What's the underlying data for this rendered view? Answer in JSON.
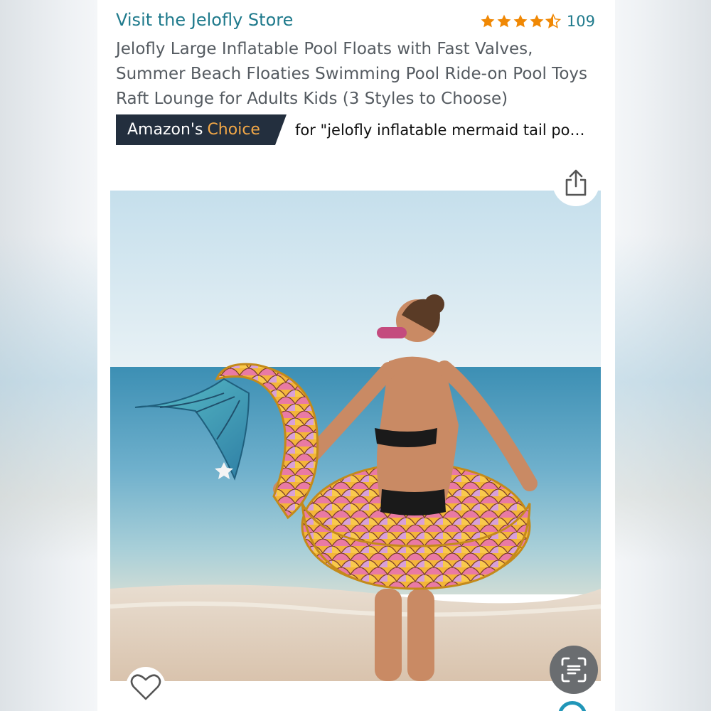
{
  "store": {
    "link_text": "Visit the Jelofly Store"
  },
  "rating": {
    "stars": 4.5,
    "count": "109",
    "star_color": "#f08804"
  },
  "product": {
    "title": "Jelofly Large Inflatable Pool Floats with Fast Valves, Summer Beach Floaties Swimming Pool Ride-on Pool Toys Raft Lounge for Adults Kids (3 Styles to Choose)"
  },
  "badge": {
    "label_prefix": "Amazon's",
    "label_highlight": "Choice",
    "query_text": "for \"jelofly inflatable mermaid tail po…",
    "background": "#232f3e",
    "highlight_color": "#f3a847"
  },
  "icons": {
    "share": "share-icon",
    "favorite": "heart-icon",
    "visual_search": "lens-scan-icon"
  },
  "colors": {
    "link": "#1f7a8c",
    "title_text": "#555b61"
  }
}
